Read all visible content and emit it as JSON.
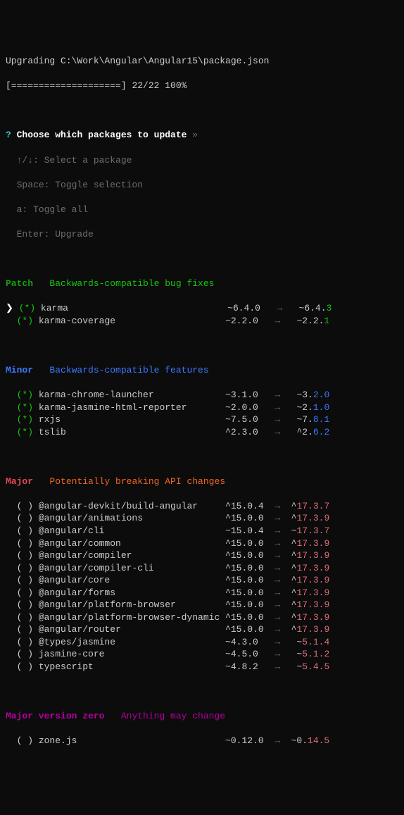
{
  "header": {
    "upgrading_prefix": "Upgrading ",
    "path": "C:\\Work\\Angular\\Angular15\\package.json",
    "progress_bar": "[====================]",
    "progress_text": "22/22 100%"
  },
  "prompt": {
    "q": "?",
    "text": "Choose which packages to update",
    "chev": "»",
    "help1": "↑/↓: Select a package",
    "help2": "Space: Toggle selection",
    "help3": "a: Toggle all",
    "help4": "Enter: Upgrade"
  },
  "sections": {
    "patch": {
      "title": "Patch",
      "desc": "Backwards-compatible bug fixes"
    },
    "minor": {
      "title": "Minor",
      "desc": "Backwards-compatible features"
    },
    "major": {
      "title": "Major",
      "desc": "Potentially breaking API changes"
    },
    "zero": {
      "title": "Major version zero",
      "desc": "Anything may change"
    }
  },
  "patch": [
    {
      "cursor": "❯",
      "sel": "(*)",
      "name": "karma",
      "from_base": "~6.4.0",
      "to_base": "~6.4.",
      "to_diff": "3"
    },
    {
      "cursor": " ",
      "sel": "(*)",
      "name": "karma-coverage",
      "from_base": "~2.2.0",
      "to_base": "~2.2.",
      "to_diff": "1"
    }
  ],
  "minor": [
    {
      "sel": "(*)",
      "name": "karma-chrome-launcher",
      "from_base": "~3.1.0",
      "to_base": "~3.",
      "to_diff": "2.0"
    },
    {
      "sel": "(*)",
      "name": "karma-jasmine-html-reporter",
      "from_base": "~2.0.0",
      "to_base": "~2.",
      "to_diff": "1.0"
    },
    {
      "sel": "(*)",
      "name": "rxjs",
      "from_base": "~7.5.0",
      "to_base": "~7.",
      "to_diff": "8.1"
    },
    {
      "sel": "(*)",
      "name": "tslib",
      "from_base": "^2.3.0",
      "to_base": "^2.",
      "to_diff": "6.2"
    }
  ],
  "major": [
    {
      "sel": "( )",
      "name": "@angular-devkit/build-angular",
      "from_base": "^15.0.4",
      "to_base": "^",
      "to_diff": "17.3.7"
    },
    {
      "sel": "( )",
      "name": "@angular/animations",
      "from_base": "^15.0.0",
      "to_base": "^",
      "to_diff": "17.3.9"
    },
    {
      "sel": "( )",
      "name": "@angular/cli",
      "from_base": "~15.0.4",
      "to_base": "~",
      "to_diff": "17.3.7"
    },
    {
      "sel": "( )",
      "name": "@angular/common",
      "from_base": "^15.0.0",
      "to_base": "^",
      "to_diff": "17.3.9"
    },
    {
      "sel": "( )",
      "name": "@angular/compiler",
      "from_base": "^15.0.0",
      "to_base": "^",
      "to_diff": "17.3.9"
    },
    {
      "sel": "( )",
      "name": "@angular/compiler-cli",
      "from_base": "^15.0.0",
      "to_base": "^",
      "to_diff": "17.3.9"
    },
    {
      "sel": "( )",
      "name": "@angular/core",
      "from_base": "^15.0.0",
      "to_base": "^",
      "to_diff": "17.3.9"
    },
    {
      "sel": "( )",
      "name": "@angular/forms",
      "from_base": "^15.0.0",
      "to_base": "^",
      "to_diff": "17.3.9"
    },
    {
      "sel": "( )",
      "name": "@angular/platform-browser",
      "from_base": "^15.0.0",
      "to_base": "^",
      "to_diff": "17.3.9"
    },
    {
      "sel": "( )",
      "name": "@angular/platform-browser-dynamic",
      "from_base": "^15.0.0",
      "to_base": "^",
      "to_diff": "17.3.9"
    },
    {
      "sel": "( )",
      "name": "@angular/router",
      "from_base": "^15.0.0",
      "to_base": "^",
      "to_diff": "17.3.9"
    },
    {
      "sel": "( )",
      "name": "@types/jasmine",
      "from_base": "~4.3.0",
      "to_base": "~",
      "to_diff": "5.1.4"
    },
    {
      "sel": "( )",
      "name": "jasmine-core",
      "from_base": "~4.5.0",
      "to_base": "~",
      "to_diff": "5.1.2"
    },
    {
      "sel": "( )",
      "name": "typescript",
      "from_base": "~4.8.2",
      "to_base": "~",
      "to_diff": "5.4.5"
    }
  ],
  "zero": [
    {
      "sel": "( )",
      "name": "zone.js",
      "from_base": "~0.12.0",
      "to_base": "~0.",
      "to_diff": "14.5"
    }
  ],
  "arrow": "→"
}
